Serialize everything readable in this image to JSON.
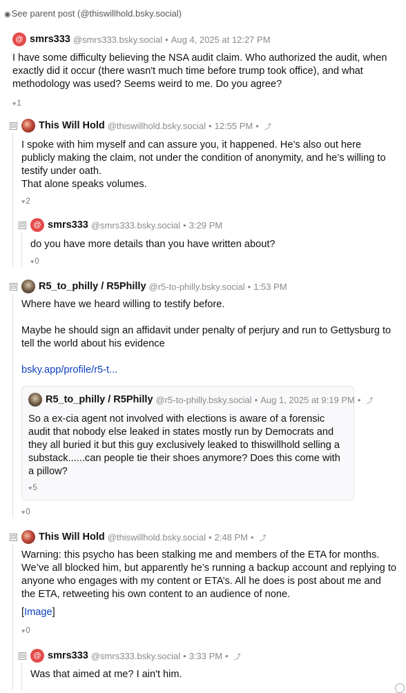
{
  "parent_link": {
    "text": "See parent post (@thiswillhold.bsky.social)"
  },
  "posts": {
    "p1": {
      "name": "smrs333",
      "handle": "@smrs333.bsky.social",
      "time": "Aug 4, 2025 at 12:27 PM",
      "body": "I have some difficulty believing the NSA audit claim. Who authorized the audit, when exactly did it occur (there wasn't much time before trump took office), and what methodology was used? Seems weird to me. Do you agree?",
      "likes": "1"
    },
    "p2": {
      "name": "This Will Hold",
      "handle": "@thiswillhold.bsky.social",
      "time": "12:55 PM",
      "body1": "I spoke with him myself and can assure you, it happened. He’s also out here publicly making the claim, not under the condition of anonymity, and he’s willing to testify under oath.",
      "body2": "That alone speaks volumes.",
      "likes": "2"
    },
    "p3": {
      "name": "smrs333",
      "handle": "@smrs333.bsky.social",
      "time": "3:29 PM",
      "body": "do you have more details than you have written about?",
      "likes": "0"
    },
    "p4": {
      "name": "R5_to_philly / R5Philly",
      "handle": "@r5-to-philly.bsky.social",
      "time": "1:53 PM",
      "body1": "Where have we heard willing to testify before.",
      "body2": "Maybe he should sign an affidavit under penalty of perjury and run to Gettysburg to tell the world about his evidence",
      "link": "bsky.app/profile/r5-t...",
      "likes": "0",
      "quote": {
        "name": "R5_to_philly / R5Philly",
        "handle": "@r5-to-philly.bsky.social",
        "time": "Aug 1, 2025 at 9:19 PM",
        "body": "So a ex-cia agent not involved with elections is aware of a forensic audit that nobody else leaked in states mostly run by Democrats and they all buried it but this guy exclusively leaked to thiswillhold selling a substack......can people tie their shoes anymore? Does this come with a pillow?",
        "likes": "5"
      }
    },
    "p5": {
      "name": "This Will Hold",
      "handle": "@thiswillhold.bsky.social",
      "time": "2:48 PM",
      "body": "Warning: this psycho has been stalking me and members of the ETA for months. We’ve all blocked him, but apparently he’s running a backup account and replying to anyone who engages with my content or ETA’s. All he does is post about me and the ETA, retweeting his own content to an audience of none.",
      "image_link": "Image",
      "likes": "0"
    },
    "p6": {
      "name": "smrs333",
      "handle": "@smrs333.bsky.social",
      "time": "3:33 PM",
      "body": "Was that aimed at me? I ain't him."
    }
  },
  "ui": {
    "toggle_glyph": "⊟",
    "separator": "•",
    "heart_glyph": "♥",
    "expand_glyph": "⤴",
    "bracket_open": "[",
    "bracket_close": "]",
    "parent_glyph": "◉",
    "at_glyph": "@"
  }
}
